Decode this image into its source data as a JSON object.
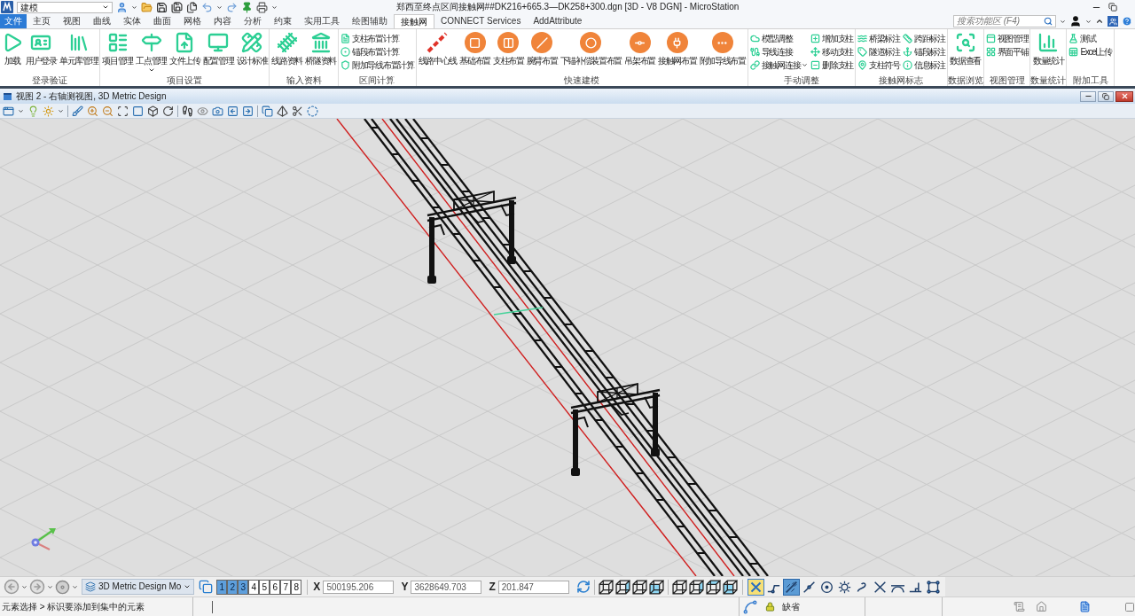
{
  "title_bar": {
    "workflow": "建模",
    "title": "郑西至终点区间接触网##DK216+665.3—DK258+300.dgn [3D - V8 DGN] - MicroStation"
  },
  "ribbon_tabs": [
    {
      "label": "文件",
      "kind": "file",
      "selected": false
    },
    {
      "label": "主页",
      "kind": "tab",
      "selected": false
    },
    {
      "label": "视图",
      "kind": "tab",
      "selected": false
    },
    {
      "label": "曲线",
      "kind": "tab",
      "selected": false
    },
    {
      "label": "实体",
      "kind": "tab",
      "selected": false
    },
    {
      "label": "曲面",
      "kind": "tab",
      "selected": false
    },
    {
      "label": "网格",
      "kind": "tab",
      "selected": false
    },
    {
      "label": "内容",
      "kind": "tab",
      "selected": false
    },
    {
      "label": "分析",
      "kind": "tab",
      "selected": false
    },
    {
      "label": "约束",
      "kind": "tab",
      "selected": false
    },
    {
      "label": "实用工具",
      "kind": "tab",
      "selected": false
    },
    {
      "label": "绘图辅助",
      "kind": "tab",
      "selected": false
    },
    {
      "label": "接触网",
      "kind": "tab",
      "selected": true
    },
    {
      "label": "CONNECT Services",
      "kind": "tab",
      "selected": false
    },
    {
      "label": "AddAttribute",
      "kind": "tab",
      "selected": false
    }
  ],
  "ribbon_search": {
    "placeholder": "搜索功能区 (F4)"
  },
  "ribbon_groups": [
    {
      "label": "登录验证",
      "items": [
        {
          "label": "加载",
          "kind": "large"
        },
        {
          "label": "用户登录",
          "kind": "large"
        },
        {
          "label": "单元库管理",
          "kind": "large"
        }
      ]
    },
    {
      "label": "项目设置",
      "items": [
        {
          "label": "项目管理",
          "kind": "large"
        },
        {
          "label": "工点管理",
          "kind": "large-menu"
        },
        {
          "label": "文件上传",
          "kind": "large"
        },
        {
          "label": "配置管理",
          "kind": "large"
        },
        {
          "label": "设计标准",
          "kind": "large"
        }
      ]
    },
    {
      "label": "输入资料",
      "items": [
        {
          "label": "线路资料",
          "kind": "large"
        },
        {
          "label": "桥隧资料",
          "kind": "large"
        }
      ]
    },
    {
      "label": "区间计算",
      "items": [
        {
          "label": "支柱布置计算",
          "kind": "small"
        },
        {
          "label": "锚段布置计算",
          "kind": "small"
        },
        {
          "label": "附加导线布置计算",
          "kind": "small"
        }
      ]
    },
    {
      "label": "快速建模",
      "items": [
        {
          "label": "线路中心线",
          "kind": "large"
        },
        {
          "label": "基础布置",
          "kind": "large"
        },
        {
          "label": "支柱布置",
          "kind": "large"
        },
        {
          "label": "腕臂布置",
          "kind": "large"
        },
        {
          "label": "下锚补偿装置布置",
          "kind": "large"
        },
        {
          "label": "吊架布置",
          "kind": "large"
        },
        {
          "label": "接触网布置",
          "kind": "large"
        },
        {
          "label": "附加导线布置",
          "kind": "large"
        }
      ]
    },
    {
      "label": "手动调整",
      "items": [
        {
          "label": "模型调整",
          "kind": "small"
        },
        {
          "label": "导线连接",
          "kind": "small"
        },
        {
          "label": "接触网连接",
          "kind": "small-menu"
        },
        {
          "label": "增加支柱",
          "kind": "small"
        },
        {
          "label": "移动支柱",
          "kind": "small"
        },
        {
          "label": "删除支柱",
          "kind": "small"
        }
      ]
    },
    {
      "label": "接触网标志",
      "items": [
        {
          "label": "桥梁标注",
          "kind": "small"
        },
        {
          "label": "隧道标注",
          "kind": "small"
        },
        {
          "label": "支柱符号",
          "kind": "small"
        },
        {
          "label": "跨距标注",
          "kind": "small"
        },
        {
          "label": "锚段标注",
          "kind": "small"
        },
        {
          "label": "信息标注",
          "kind": "small"
        }
      ]
    },
    {
      "label": "数据浏览",
      "items": [
        {
          "label": "数据查看",
          "kind": "large"
        }
      ]
    },
    {
      "label": "视图管理",
      "items": [
        {
          "label": "视图管理",
          "kind": "small"
        },
        {
          "label": "界面平铺",
          "kind": "small"
        }
      ]
    },
    {
      "label": "数量统计",
      "items": [
        {
          "label": "数量统计",
          "kind": "large"
        }
      ]
    },
    {
      "label": "附加工具",
      "items": [
        {
          "label": "测试",
          "kind": "small"
        },
        {
          "label": "Excel上传",
          "kind": "small"
        }
      ]
    }
  ],
  "view_window": {
    "title": "视图 2 - 右轴测视图, 3D Metric Design"
  },
  "bottom_toolbar": {
    "view_group": "3D Metric Design Mo",
    "views": [
      {
        "label": "1",
        "selected": true
      },
      {
        "label": "2",
        "selected": true
      },
      {
        "label": "3",
        "selected": true
      },
      {
        "label": "4",
        "selected": false
      },
      {
        "label": "5",
        "selected": false
      },
      {
        "label": "6",
        "selected": false
      },
      {
        "label": "7",
        "selected": false
      },
      {
        "label": "8",
        "selected": false
      }
    ],
    "coordinates": [
      {
        "axis": "X",
        "value": "500195.206"
      },
      {
        "axis": "Y",
        "value": "3628649.703"
      },
      {
        "axis": "Z",
        "value": "201.847"
      }
    ],
    "snap_modes": [
      {
        "kind": "lock",
        "selected": true
      },
      {
        "kind": "snap",
        "selected": false
      },
      {
        "kind": "snap",
        "selected": true
      },
      {
        "kind": "snap",
        "selected": false
      },
      {
        "kind": "snap",
        "selected": false
      },
      {
        "kind": "snap",
        "selected": false
      },
      {
        "kind": "snap",
        "selected": false
      },
      {
        "kind": "snap",
        "selected": false
      },
      {
        "kind": "snap",
        "selected": false
      },
      {
        "kind": "snap",
        "selected": false
      },
      {
        "kind": "snap",
        "selected": false
      }
    ]
  },
  "status_bar": {
    "prompt": "元素选择 > 标识要添加到集中的元素",
    "active_level": "缺省"
  }
}
